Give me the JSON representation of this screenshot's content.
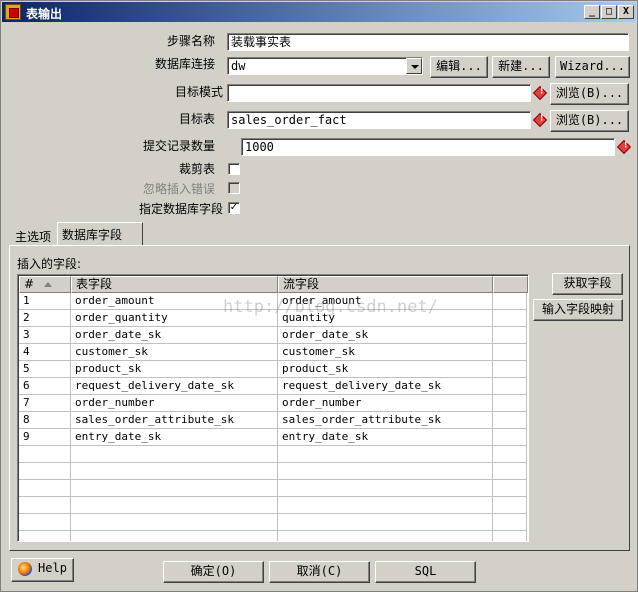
{
  "window": {
    "title": "表输出",
    "min": "_",
    "max": "□",
    "close": "X"
  },
  "form": {
    "step_name_label": "步骤名称",
    "step_name_value": "装载事实表",
    "connection_label": "数据库连接",
    "connection_value": "dw",
    "edit_button": "编辑...",
    "new_button": "新建...",
    "wizard_button": "Wizard...",
    "schema_label": "目标模式",
    "schema_value": "",
    "browse_button": "浏览(B)...",
    "table_label": "目标表",
    "table_value": "sales_order_fact",
    "browse_button2": "浏览(B)...",
    "commit_label": "提交记录数量",
    "commit_value": "1000",
    "truncate_label": "裁剪表",
    "truncate_checked": "",
    "ignore_errors_label": "忽略插入错误",
    "ignore_errors_checked": "",
    "specify_fields_label": "指定数据库字段",
    "specify_fields_checked": "✓"
  },
  "tabs": [
    {
      "label": "主选项"
    },
    {
      "label": "数据库字段"
    }
  ],
  "fields_section": {
    "title": "插入的字段:",
    "get_fields_button": "获取字段",
    "mapping_button": "输入字段映射",
    "columns": {
      "num": "#",
      "table_field": "表字段",
      "stream_field": "流字段"
    },
    "rows": [
      {
        "num": "1",
        "table_field": "order_amount",
        "stream_field": "order_amount"
      },
      {
        "num": "2",
        "table_field": "order_quantity",
        "stream_field": "quantity"
      },
      {
        "num": "3",
        "table_field": "order_date_sk",
        "stream_field": "order_date_sk"
      },
      {
        "num": "4",
        "table_field": "customer_sk",
        "stream_field": "customer_sk"
      },
      {
        "num": "5",
        "table_field": "product_sk",
        "stream_field": "product_sk"
      },
      {
        "num": "6",
        "table_field": "request_delivery_date_sk",
        "stream_field": "request_delivery_date_sk"
      },
      {
        "num": "7",
        "table_field": "order_number",
        "stream_field": "order_number"
      },
      {
        "num": "8",
        "table_field": "sales_order_attribute_sk",
        "stream_field": "sales_order_attribute_sk"
      },
      {
        "num": "9",
        "table_field": "entry_date_sk",
        "stream_field": "entry_date_sk"
      }
    ]
  },
  "watermark": "http://blog.csdn.net/",
  "footer": {
    "help_button": "Help",
    "ok_button": "确定(O)",
    "cancel_button": "取消(C)",
    "sql_button": "SQL"
  },
  "colors": {
    "titlebar_start": "#0a246a",
    "titlebar_end": "#a6caf0",
    "face": "#d4d0c8"
  }
}
